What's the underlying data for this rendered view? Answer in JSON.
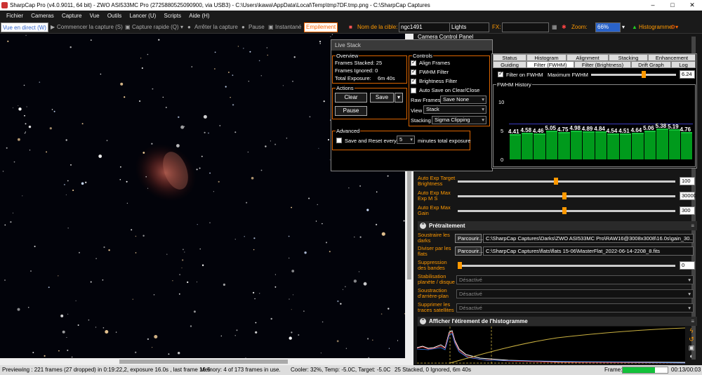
{
  "titlebar": {
    "title": "SharpCap Pro (v4.0.9011, 64 bit) - ZWO ASI533MC Pro (272588052509090​0, via USB3) - C:\\Users\\kawa\\AppData\\Local\\Temp\\tmp7DF.tmp.png - C:\\SharpCap Captures",
    "min": "–",
    "max": "□",
    "close": "✕"
  },
  "menu": [
    "Fichier",
    "Cameras",
    "Capture",
    "Vue",
    "Outils",
    "Lancer (U)",
    "Scripts",
    "Aide (H)"
  ],
  "toolbar": {
    "live": "Vue en direct (W)",
    "start": "Commencer la capture (S)",
    "quick": "Capture rapide (Q)",
    "stop": "Arrêter la capture",
    "pause": "Pause",
    "snap": "Instantané",
    "stack": "Empilement",
    "target_label": "Nom de la cible:",
    "target": "ngc1491",
    "frame_type": "Lights",
    "fx_label": "FX:",
    "fx": "",
    "zoom_label": "Zoom:",
    "zoom": "66%",
    "histo": "Histogramme"
  },
  "panel_title": "Camera Control Panel",
  "live_stack": {
    "title": "Live Stack",
    "overview": {
      "title": "Overview",
      "stacked": "Frames Stacked: 25",
      "ignored": "Frames Ignored:  0",
      "exposure_label": "Total Exposure:",
      "exposure": "6m 40s"
    },
    "actions": {
      "title": "Actions",
      "clear": "Clear",
      "save": "Save",
      "pause": "Pause"
    },
    "advanced": {
      "title": "Advanced",
      "reset_label": "Save and Reset every",
      "reset_value": "5",
      "reset_unit": "minutes total exposure"
    },
    "controls": {
      "title": "Controls",
      "align": "Align Frames",
      "fwhm": "FWHM Filter",
      "bright": "Brightness Filter",
      "autosave": "Auto Save on Clear/Close",
      "raw_label": "Raw Frames",
      "raw": "Save None",
      "view_label": "View",
      "view": "Stack",
      "stacking_label": "Stacking",
      "stacking": "Sigma Clipping"
    },
    "tabs_row1": [
      "Status",
      "Histogram",
      "Alignment",
      "Stacking",
      "Enhancement"
    ],
    "tabs_row2": [
      "Guiding",
      "Filter (FWHM)",
      "Filter (Brightness)",
      "Drift Graph",
      "Log"
    ],
    "filter": {
      "enable": "Filter on FWHM",
      "max_label": "Maximum FWHM",
      "max_value": "6.24",
      "history_title": "FWHM History",
      "axis": [
        "10",
        "5",
        "0"
      ],
      "max_fraction": 0.624
    }
  },
  "chart_data": {
    "type": "bar",
    "title": "FWHM History",
    "ylim": [
      0,
      10
    ],
    "values": [
      4.41,
      4.58,
      4.46,
      5.05,
      4.75,
      4.98,
      4.89,
      4.84,
      4.54,
      4.51,
      4.64,
      5.06,
      5.38,
      5.19,
      4.76
    ],
    "labels": [
      "4.41",
      "4.58",
      "4.46",
      "5.05",
      "4.75",
      "4.98",
      "4.89",
      "4.84",
      "4.54",
      "4.51",
      "4.64",
      "5.06",
      "5.38",
      "5.19",
      "4.76"
    ],
    "threshold": 6.24
  },
  "auto_exp": [
    {
      "label": "Auto Exp Target Brightness",
      "value": "100",
      "fraction": 0.45
    },
    {
      "label": "Auto Exp Max Exp M S",
      "value": "30000",
      "fraction": 0.49
    },
    {
      "label": "Auto Exp Max Gain",
      "value": "300",
      "fraction": 0.49
    }
  ],
  "preproc": {
    "title": "Prétraitement",
    "darks_label": "Soustraire les darks",
    "darks_path": "C:\\SharpCap Captures\\Darks\\ZWO ASI533MC Pro\\RAW16@3008x3008\\16.0s\\gain_30...",
    "browse": "Parcourir...",
    "flats_label": "Diviser par les flats",
    "flats_path": "C:\\SharpCap Captures\\flats\\flats 15-06\\MasterFlat_2022-06-14-2208_8.fits",
    "banding_label": "Suppression des bandes",
    "banding_value": "0",
    "stab_label": "Stabilisation planète / disque",
    "bg_label": "Soustraction d'arrière-plan",
    "sat_label": "Supprimer les traces satellites",
    "disabled": "Désactivé"
  },
  "histo_section": {
    "title": "Afficher l'étirement de l'histogramme"
  },
  "status": {
    "preview": "Previewing : 221 frames (27 dropped) in 0:19:22,2, exposure 16.0s , last frame 16.5",
    "memory": "Memory: 4 of 173 frames in use.",
    "cooler": "Cooler: 32%, Temp: -5.0C, Target: -5.0C",
    "stack": "25 Stacked, 0 Ignored, 6m 40s",
    "frame_label": "Frame:",
    "frame_progress": 0.72,
    "time": "00:13/00:03"
  },
  "colors": {
    "accent": "#ff9900",
    "bar": "#009a1c",
    "nebula": "#8a3a30"
  }
}
